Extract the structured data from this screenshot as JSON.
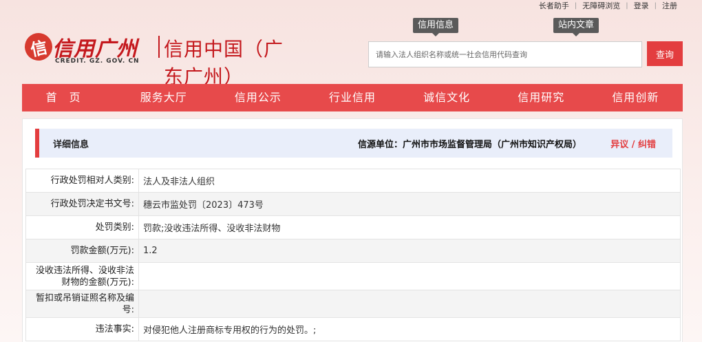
{
  "toplinks": [
    "长者助手",
    "无障碍浏览",
    "登录",
    "注册"
  ],
  "logo": {
    "mark": "信",
    "cn": "信用广州",
    "en": "CREDIT. GZ. GOV. CN",
    "sub": "信用中国（广东广州）"
  },
  "search": {
    "tab1": "信用信息",
    "tab2": "站内文章",
    "placeholder": "请输入法人组织名称或统一社会信用代码查询",
    "button": "查询"
  },
  "nav": [
    "首页",
    "服务大厅",
    "信用公示",
    "行业信用",
    "诚信文化",
    "信用研究",
    "信用创新"
  ],
  "detail": {
    "title": "详细信息",
    "source": "信源单位：广州市市场监督管理局（广州市知识产权局）",
    "objection": "异议 / 纠错"
  },
  "rows": [
    {
      "label": "行政处罚相对人类别:",
      "value": "法人及非法人组织"
    },
    {
      "label": "行政处罚决定书文号:",
      "value": "穗云市监处罚〔2023〕473号"
    },
    {
      "label": "处罚类别:",
      "value": "罚款;没收违法所得、没收非法财物"
    },
    {
      "label": "罚款金额(万元):",
      "value": "1.2"
    },
    {
      "label": "没收违法所得、没收非法财物的金额(万元):",
      "value": ""
    },
    {
      "label": "暂扣或吊销证照名称及编号:",
      "value": ""
    },
    {
      "label": "违法事实:",
      "value": "对侵犯他人注册商标专用权的行为的处罚。;"
    }
  ]
}
